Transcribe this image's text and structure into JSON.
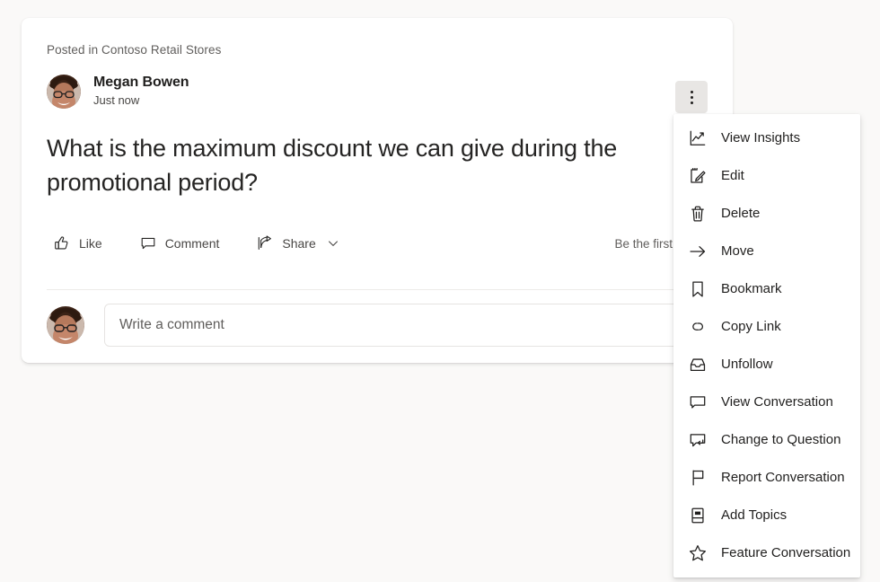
{
  "post": {
    "posted_in": "Posted in Contoso Retail Stores",
    "author_name": "Megan Bowen",
    "timestamp": "Just now",
    "body": "What is the maximum discount we can give during the promotional period?",
    "first_to_like": "Be the first to like"
  },
  "actions": [
    {
      "id": "like",
      "label": "Like",
      "icon": "thumbs-up-icon"
    },
    {
      "id": "comment",
      "label": "Comment",
      "icon": "comment-bubble-icon"
    },
    {
      "id": "share",
      "label": "Share",
      "icon": "share-arrow-icon",
      "has_chevron": true
    }
  ],
  "comment_box": {
    "placeholder": "Write a comment",
    "value": ""
  },
  "overflow_button": {
    "name": "more-options-button",
    "icon": "ellipsis-vertical-icon"
  },
  "context_menu": {
    "items": [
      {
        "label": "View Insights",
        "icon": "insights-chart-icon"
      },
      {
        "label": "Edit",
        "icon": "edit-pencil-icon"
      },
      {
        "label": "Delete",
        "icon": "trash-icon"
      },
      {
        "label": "Move",
        "icon": "arrow-right-icon"
      },
      {
        "label": "Bookmark",
        "icon": "bookmark-icon"
      },
      {
        "label": "Copy Link",
        "icon": "link-chain-icon"
      },
      {
        "label": "Unfollow",
        "icon": "unfollow-inbox-icon"
      },
      {
        "label": "View Conversation",
        "icon": "conversation-bubble-icon"
      },
      {
        "label": "Change to Question",
        "icon": "change-to-question-icon"
      },
      {
        "label": "Report Conversation",
        "icon": "flag-icon"
      },
      {
        "label": "Add Topics",
        "icon": "topics-book-icon"
      },
      {
        "label": "Feature Conversation",
        "icon": "star-icon"
      }
    ]
  },
  "colors": {
    "page_background": "#faf9f8",
    "card_background": "#ffffff",
    "text_primary": "#201f1e",
    "text_secondary": "#605e5c",
    "divider": "#edebe9",
    "button_active_background": "#e8e6e4"
  }
}
